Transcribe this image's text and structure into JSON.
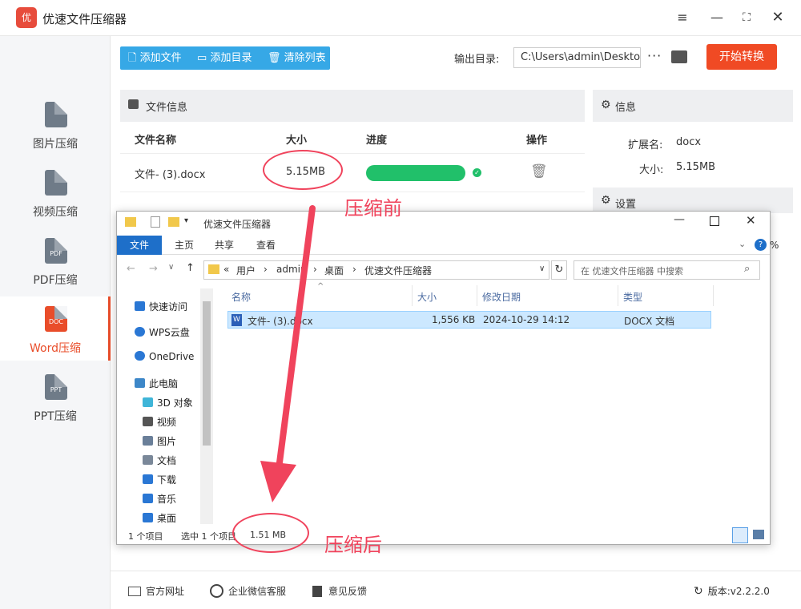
{
  "app": {
    "title": "优速文件压缩器",
    "logo_text": "优"
  },
  "sidebar": {
    "items": [
      {
        "label": "图片压缩",
        "badge": ""
      },
      {
        "label": "视频压缩",
        "badge": ""
      },
      {
        "label": "PDF压缩",
        "badge": "PDF"
      },
      {
        "label": "Word压缩",
        "badge": "DOC"
      },
      {
        "label": "PPT压缩",
        "badge": "PPT"
      }
    ],
    "active": "Word压缩"
  },
  "toolbar": {
    "add_file": "添加文件",
    "add_dir": "添加目录",
    "clear_list": "清除列表",
    "output_label": "输出目录:",
    "output_path": "C:\\Users\\admin\\Deskto",
    "more": "···",
    "start": "开始转换"
  },
  "file_panel": {
    "title": "文件信息",
    "columns": {
      "name": "文件名称",
      "size": "大小",
      "progress": "进度",
      "action": "操作"
    },
    "rows": [
      {
        "name": "文件- (3).docx",
        "size": "5.15MB",
        "progress": 1.0
      }
    ]
  },
  "info_panel": {
    "title": "信息",
    "ext_label": "扩展名:",
    "ext_value": "docx",
    "size_label": "大小:",
    "size_value": "5.15MB",
    "settings_title": "设置"
  },
  "footer": {
    "website": "官方网址",
    "wechat": "企业微信客服",
    "feedback": "意见反馈",
    "version": "版本:v2.2.2.0"
  },
  "explorer": {
    "title": "优速文件压缩器",
    "ribbon": {
      "file": "文件",
      "home": "主页",
      "share": "共享",
      "view": "查看"
    },
    "address": [
      "«",
      "用户",
      "admin",
      "桌面",
      "优速文件压缩器"
    ],
    "search_placeholder": "在 优速文件压缩器 中搜索",
    "nav": [
      {
        "label": "快速访问",
        "color": "#2a77d4"
      },
      {
        "label": "WPS云盘",
        "color": "#2a77d4"
      },
      {
        "label": "OneDrive",
        "color": "#2a77d4"
      },
      {
        "label": "此电脑",
        "color": "#3d87c8"
      },
      {
        "label": "3D 对象",
        "color": "#3fb5d8"
      },
      {
        "label": "视频",
        "color": "#555555"
      },
      {
        "label": "图片",
        "color": "#6a7f99"
      },
      {
        "label": "文档",
        "color": "#7a8899"
      },
      {
        "label": "下载",
        "color": "#2a77d4"
      },
      {
        "label": "音乐",
        "color": "#2a77d4"
      },
      {
        "label": "桌面",
        "color": "#2a77d4"
      }
    ],
    "columns": {
      "name": "名称",
      "size": "大小",
      "modified": "修改日期",
      "type": "类型"
    },
    "rows": [
      {
        "name": "文件- (3).docx",
        "size": "1,556 KB",
        "modified": "2024-10-29 14:12",
        "type": "DOCX 文档"
      }
    ],
    "status": {
      "count": "1 个项目",
      "selected": "选中 1 个项目",
      "size": "1.51 MB"
    },
    "right_edge_glyph": "%"
  },
  "annotations": {
    "before": "压缩前",
    "after": "压缩后"
  },
  "colors": {
    "accent": "#f04a24",
    "blue": "#36a8e6",
    "progress": "#21c06a",
    "annotation": "#f0435c"
  }
}
